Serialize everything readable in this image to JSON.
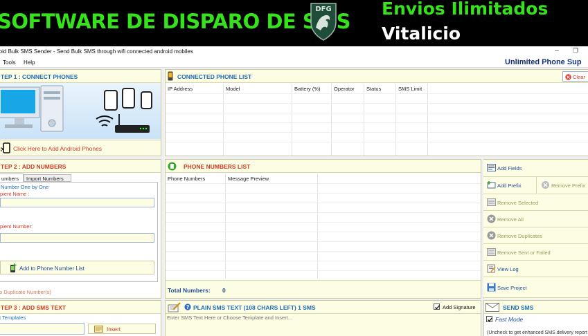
{
  "banner": {
    "title": "SOFTWARE DE DISPARO DE SMS",
    "logo_text": "DFG",
    "promo_line1": "Envios Ilimitados",
    "promo_line2": "Vitalicio"
  },
  "window": {
    "title": "roid Bulk SMS Sender - Send Bulk SMS through wifi connected android mobiles",
    "minimize_icon": "minimize-icon",
    "restore_icon": "restore-icon",
    "restore_glyph": "❐"
  },
  "menu": {
    "items": [
      "Tools",
      "Help"
    ],
    "right_text": "Unlimited Phone Sup"
  },
  "step1": {
    "title": "TEP 1 : CONNECT PHONES",
    "add_phones_label": "Click Here to Add Android Phones"
  },
  "connected_list": {
    "title": "CONNECTED PHONE LIST",
    "clear_label": "Clear",
    "columns": [
      "IP Address",
      "Model",
      "Battery (%)",
      "Operator",
      "Status",
      "SMS Limit"
    ]
  },
  "step2": {
    "title": "TEP 2 : ADD NUMBERS",
    "tabs": [
      "umbers",
      "Import Numbers"
    ],
    "section_label": "Number One by One",
    "name_label": "pient Name :",
    "number_label": "pient Number:",
    "name_value": "",
    "number_value": "",
    "add_button_label": "Add to Phone Number List",
    "skip_duplicates_label": "p Duplicate Number(s)"
  },
  "numbers_list": {
    "title": "PHONE NUMBERS LIST",
    "columns": [
      "Phone Numbers",
      "Message Preview"
    ],
    "total_label": "Total Numbers:",
    "total_value": "0"
  },
  "side_actions": {
    "add_fields": "Add Fields",
    "add_prefix": "Add Prefix",
    "remove_prefix": "Remove Prefix",
    "remove_selected": "Remove Selected",
    "remove_all": "Remove All",
    "remove_duplicates": "Remove Duplicates",
    "remove_sent_failed": "Remove Sent or Failed",
    "view_log": "View Log",
    "save_project": "Save Project"
  },
  "step3": {
    "title": "TEP 3 : ADD SMS TEXT",
    "templates_label": "t Templates",
    "insert_label": "Insert",
    "template_value": ""
  },
  "sms_text": {
    "title": "PLAIN SMS TEXT (108 CHARS LEFT) 1 SMS",
    "signature_label": "Add Signature",
    "signature_checked": true,
    "placeholder": "Enter SMS Text Here or Choose Template and Insert...",
    "value": ""
  },
  "send": {
    "title": "SEND SMS",
    "fast_mode_label": "Fast Mode",
    "fast_mode_checked": true,
    "note": "(Uncheck to get enhanced SMS delivery report"
  },
  "colors": {
    "banner_green": "#35e21b",
    "header_blue": "#1e6cb6",
    "header_red": "#c83c2a",
    "panel_yellow": "#fdfde3",
    "menu_right_navy": "#14307a"
  }
}
